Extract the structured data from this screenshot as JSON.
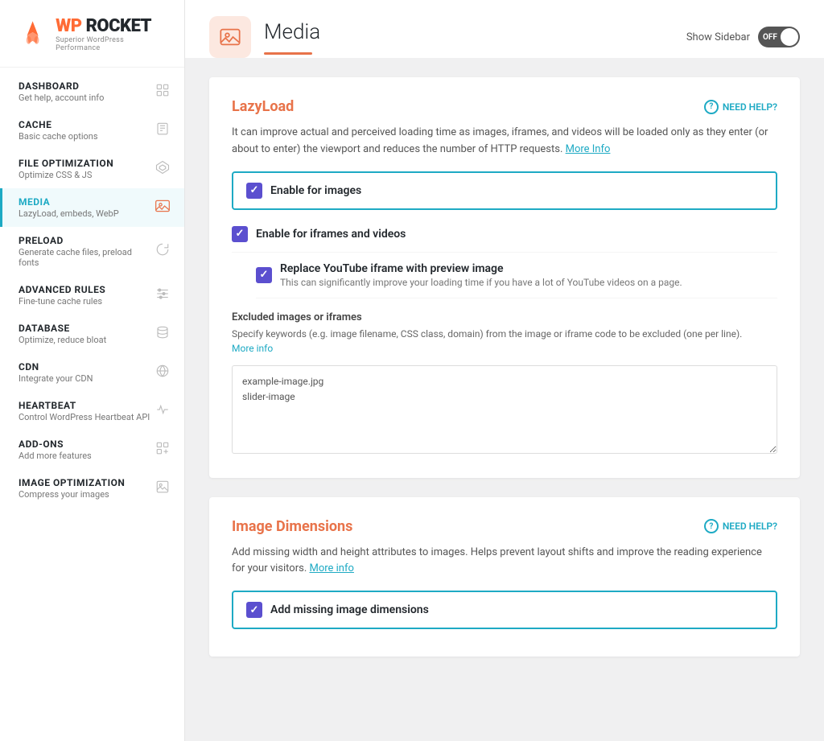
{
  "sidebar": {
    "logo": {
      "wp": "WP",
      "rocket": "ROCKET",
      "subtitle": "Superior WordPress Performance"
    },
    "items": [
      {
        "id": "dashboard",
        "title": "DASHBOARD",
        "subtitle": "Get help, account info",
        "icon": "🏠",
        "active": false
      },
      {
        "id": "cache",
        "title": "CACHE",
        "subtitle": "Basic cache options",
        "icon": "📄",
        "active": false
      },
      {
        "id": "file-optimization",
        "title": "FILE OPTIMIZATION",
        "subtitle": "Optimize CSS & JS",
        "icon": "⬡",
        "active": false
      },
      {
        "id": "media",
        "title": "MEDIA",
        "subtitle": "LazyLoad, embeds, WebP",
        "icon": "🖼",
        "active": true
      },
      {
        "id": "preload",
        "title": "PRELOAD",
        "subtitle": "Generate cache files, preload fonts",
        "icon": "↻",
        "active": false
      },
      {
        "id": "advanced-rules",
        "title": "ADVANCED RULES",
        "subtitle": "Fine-tune cache rules",
        "icon": "≡",
        "active": false
      },
      {
        "id": "database",
        "title": "DATABASE",
        "subtitle": "Optimize, reduce bloat",
        "icon": "🗄",
        "active": false
      },
      {
        "id": "cdn",
        "title": "CDN",
        "subtitle": "Integrate your CDN",
        "icon": "🌐",
        "active": false
      },
      {
        "id": "heartbeat",
        "title": "HEARTBEAT",
        "subtitle": "Control WordPress Heartbeat API",
        "icon": "♥",
        "active": false
      },
      {
        "id": "add-ons",
        "title": "ADD-ONS",
        "subtitle": "Add more features",
        "icon": "⊞",
        "active": false
      },
      {
        "id": "image-optimization",
        "title": "IMAGE OPTIMIZATION",
        "subtitle": "Compress your images",
        "icon": "🗜",
        "active": false
      }
    ]
  },
  "header": {
    "icon": "🖼",
    "title": "Media",
    "show_sidebar_label": "Show Sidebar",
    "toggle_state": "OFF"
  },
  "lazyload_section": {
    "title": "LazyLoad",
    "need_help_label": "NEED HELP?",
    "description": "It can improve actual and perceived loading time as images, iframes, and videos will be loaded only as they enter (or about to enter) the viewport and reduces the number of HTTP requests.",
    "more_info_link": "More Info",
    "options": [
      {
        "id": "enable-images",
        "label": "Enable for images",
        "checked": true,
        "highlight": true,
        "sublabel": null
      },
      {
        "id": "enable-iframes",
        "label": "Enable for iframes and videos",
        "checked": true,
        "highlight": false,
        "sublabel": null
      },
      {
        "id": "replace-youtube",
        "label": "Replace YouTube iframe with preview image",
        "checked": true,
        "highlight": false,
        "sublabel": "This can significantly improve your loading time if you have a lot of YouTube videos on a page.",
        "sub": true
      }
    ],
    "excluded_section": {
      "title": "Excluded images or iframes",
      "description": "Specify keywords (e.g. image filename, CSS class, domain) from the image or iframe code to be excluded (one per line).",
      "more_info_link": "More info",
      "textarea_placeholder": "example-image.jpg\nslider-image",
      "textarea_value": "example-image.jpg\nslider-image"
    }
  },
  "image_dimensions_section": {
    "title": "Image Dimensions",
    "need_help_label": "NEED HELP?",
    "description": "Add missing width and height attributes to images. Helps prevent layout shifts and improve the reading experience for your visitors.",
    "more_info_link": "More info",
    "options": [
      {
        "id": "add-missing-dimensions",
        "label": "Add missing image dimensions",
        "checked": true,
        "highlight": true
      }
    ]
  }
}
